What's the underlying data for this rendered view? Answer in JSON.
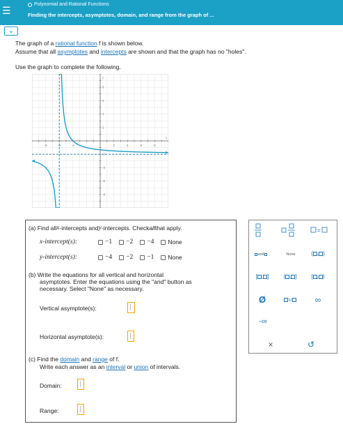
{
  "header": {
    "menu_icon": "☰",
    "breadcrumb": "Polynomial and Rational Functions",
    "title": "Finding the intercepts, asymptotes, domain, and range from the graph of ..."
  },
  "collapse_icon": "chevron-down-icon",
  "intro": {
    "line1_a": "The graph of a ",
    "line1_link": "rational function",
    "line1_b": " f is shown below.",
    "line2_a": "Assume that all ",
    "line2_link1": "asymptotes",
    "line2_b": " and ",
    "line2_link2": "intercepts",
    "line2_c": " are shown and that the graph has no \"holes\".",
    "line3": "Use the graph to complete the following."
  },
  "graph": {
    "x_ticks": [
      "-8",
      "-6",
      "-4",
      "2",
      "4",
      "6",
      "8"
    ],
    "y_ticks": [
      "8",
      "6",
      "4",
      "2",
      "-2",
      "-4",
      "-6",
      "-8"
    ],
    "x_axis_label": "x",
    "y_axis_label": "y",
    "vertical_asymptote_x": -6,
    "horizontal_asymptote_y": -2,
    "curve_color": "#1ba0c6",
    "asymptote_color": "#1a73b8"
  },
  "partA": {
    "title_a": "(a) Find all ",
    "title_x": "x",
    "title_b": "-intercepts and ",
    "title_y": "y",
    "title_c": "-intercepts. Check ",
    "title_all": "all",
    "title_d": " that apply.",
    "x_label": "x-intercept(s):",
    "x_options": [
      "−1",
      "−2",
      "−4",
      "None"
    ],
    "y_label": "y-intercept(s):",
    "y_options": [
      "−4",
      "−2",
      "−1",
      "None"
    ]
  },
  "partB": {
    "line1": "(b) Write the equations for all vertical and horizontal",
    "line2": "asymptotes. Enter the equations using the \"and\" button as",
    "line3": "necessary. Select \"None\" as necessary.",
    "vert_label": "Vertical asymptote(s):",
    "horiz_label": "Horizontal asymptote(s):"
  },
  "partC": {
    "line1_a": "(c) Find the ",
    "line1_link1": "domain",
    "line1_b": " and ",
    "line1_link2": "range",
    "line1_c": " of f.",
    "line2_a": "Write each answer as an ",
    "line2_link1": "interval",
    "line2_b": " or ",
    "line2_link2": "union",
    "line2_c": " of intervals.",
    "domain_label": "Domain:",
    "range_label": "Range:"
  },
  "palette": {
    "and_label": "and",
    "none_label": "None",
    "empty_set": "Ø",
    "union": "∪",
    "infinity": "∞",
    "neg_infinity": "-∞",
    "clear": "×",
    "undo": "↺"
  }
}
